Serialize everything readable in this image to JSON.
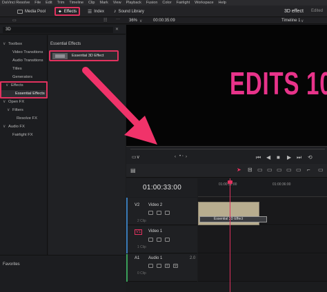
{
  "menu": {
    "items": [
      "DaVinci Resolve",
      "File",
      "Edit",
      "Trim",
      "Timeline",
      "Clip",
      "Mark",
      "View",
      "Playback",
      "Fusion",
      "Color",
      "Fairlight",
      "Workspace",
      "Help"
    ]
  },
  "toolbar": {
    "media_pool": "Media Pool",
    "effects": "Effects",
    "index": "Index",
    "sound_library": "Sound Library",
    "project_title": "3D effect",
    "status": "Edited"
  },
  "viewer_bar": {
    "zoom": "36%",
    "timecode": "00:00:35:09",
    "timeline_name": "Timeline 1"
  },
  "search": {
    "value": "3D"
  },
  "tree": [
    {
      "label": "Toolbox",
      "chevron": "∨"
    },
    {
      "label": "Video Transitions",
      "chevron": ""
    },
    {
      "label": "Audio Transitions",
      "chevron": ""
    },
    {
      "label": "Titles",
      "chevron": ""
    },
    {
      "label": "Generators",
      "chevron": ""
    },
    {
      "label": "Effects",
      "chevron": "∨"
    },
    {
      "label": "Essential Effects",
      "chevron": ""
    },
    {
      "label": "Open FX",
      "chevron": "∨"
    },
    {
      "label": "Filters",
      "chevron": "∨"
    },
    {
      "label": "Resolve FX",
      "chevron": ""
    },
    {
      "label": "Audio FX",
      "chevron": "∨"
    },
    {
      "label": "Fairlight FX",
      "chevron": ""
    }
  ],
  "effects_list": {
    "header": "Essential Effects",
    "item": "Essential 3D Effect"
  },
  "favorites": "Favorites",
  "viewer": {
    "text": "EDITS 10"
  },
  "timeline": {
    "timecode": "01:00:33:00",
    "ruler": [
      "01:00:32:00",
      "01:00:36:00"
    ],
    "tracks": [
      {
        "badge": "V2",
        "name": "Video 2",
        "clips": "2 Clip"
      },
      {
        "badge": "V1",
        "name": "Video 1",
        "clips": "1 Clip"
      },
      {
        "badge": "A1",
        "name": "Audio 1",
        "clips": "0 Clip",
        "level": "2.0"
      }
    ],
    "clip_label": "Essential 3D Effect",
    "mini_s": "S",
    "mini_m": "M"
  },
  "colors": {
    "accent": "#e2325f",
    "viewer_text": "#e8338a",
    "arrow": "#f0336a"
  }
}
